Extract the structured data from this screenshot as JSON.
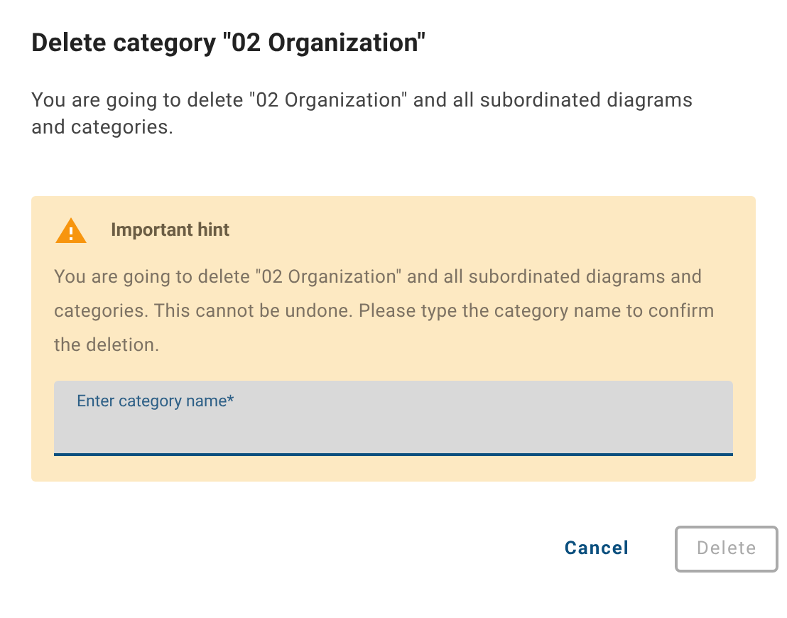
{
  "dialog": {
    "title": "Delete category \"02 Organization\"",
    "message": "You are going to delete \"02 Organization\" and all subordinated diagrams and categories."
  },
  "hint": {
    "title": "Important hint",
    "text": "You are going to delete \"02 Organization\" and all subordinated diagrams and categories. This cannot be undone. Please type the category name to confirm the deletion.",
    "field": {
      "label": "Enter category name*"
    }
  },
  "buttons": [
    {
      "label": "Cancel",
      "kind": "text",
      "disabled": false
    },
    {
      "label": "Delete",
      "kind": "outlined",
      "disabled": true
    }
  ]
}
